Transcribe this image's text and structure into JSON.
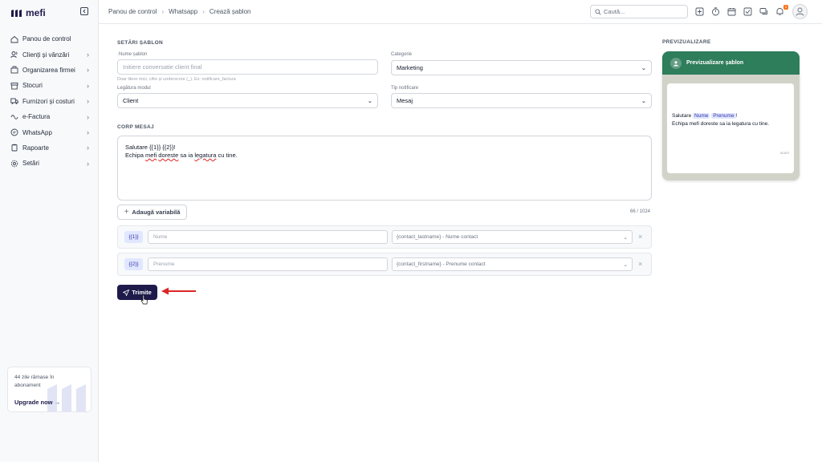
{
  "app": {
    "name": "mefi"
  },
  "sidebar": {
    "items": [
      {
        "label": "Panou de control",
        "icon": "home-icon"
      },
      {
        "label": "Clienți și vânzări",
        "icon": "users-icon"
      },
      {
        "label": "Organizarea firmei",
        "icon": "building-icon"
      },
      {
        "label": "Stocuri",
        "icon": "box-icon"
      },
      {
        "label": "Furnizori și costuri",
        "icon": "truck-icon"
      },
      {
        "label": "e-Factura",
        "icon": "invoice-icon"
      },
      {
        "label": "WhatsApp",
        "icon": "whatsapp-icon"
      },
      {
        "label": "Rapoarte",
        "icon": "clipboard-icon"
      },
      {
        "label": "Setări",
        "icon": "gear-icon"
      }
    ],
    "upgrade": {
      "days_text": "44 zile rămase în abonament",
      "link": "Upgrade now"
    }
  },
  "header": {
    "breadcrumb": [
      "Panou de control",
      "Whatsapp",
      "Crează șablon"
    ],
    "search_placeholder": "Caută...",
    "notification_count": "1"
  },
  "settings": {
    "title": "SETĂRI ȘABLON",
    "name_label": "Nume șablon",
    "name_placeholder": "Initiere conversatie client final",
    "name_help": "Doar litere mici, cifre și underscore (_). Ex: notificare_factura",
    "category_label": "Categorie",
    "category_value": "Marketing",
    "module_label": "Legătura modul",
    "module_value": "Client",
    "notif_label": "Tip notificare",
    "notif_value": "Mesaj"
  },
  "body": {
    "title": "CORP MESAJ",
    "line1": "Salutare {{1}} {{2}}!",
    "line2_pre": "Echipa ",
    "line2_w1": "mefi",
    "line2_mid1": " ",
    "line2_w2": "doreste",
    "line2_mid2": " sa ia ",
    "line2_w3": "legatura",
    "line2_post": " cu tine.",
    "add_variable": "Adaugă variabilă",
    "counter": "66 / 1024"
  },
  "variables": [
    {
      "tag": "{{1}}",
      "placeholder": "Nume",
      "mapping": "{contact_lastname} - Nume contact"
    },
    {
      "tag": "{{2}}",
      "placeholder": "Prenume",
      "mapping": "{contact_firstname} - Prenume contact"
    }
  ],
  "send_label": "Trimite",
  "preview": {
    "title": "PREVIZUALIZARE",
    "header": "Previzualizare șablon",
    "greeting": "Salutare",
    "chip1": "Nume",
    "chip2": "Prenume",
    "excl": "!",
    "line2": "Echipa mefi doreste sa ia legatura cu tine.",
    "time": "acum"
  },
  "colors": {
    "brand": "#1e1b4b",
    "whatsapp": "#2e7d5b",
    "arrow": "#dc2626",
    "badge": "#f97316"
  }
}
